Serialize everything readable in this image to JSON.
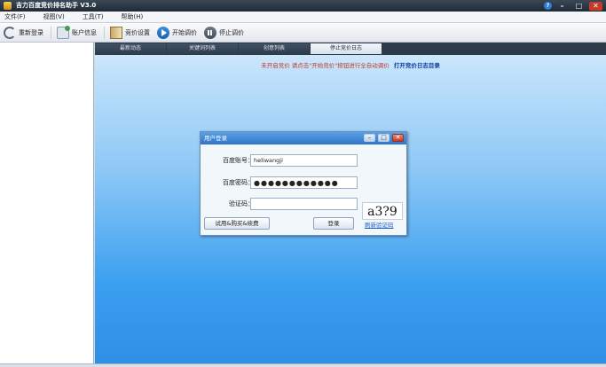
{
  "window": {
    "title": "吉力百度竞价排名助手 V3.0"
  },
  "menu": {
    "items": [
      "文件(F)",
      "视图(V)",
      "工具(T)",
      "帮助(H)"
    ]
  },
  "toolbar": {
    "relogin": "重新登录",
    "account": "账户信息",
    "bid_settings": "竞价设置",
    "start": "开始调价",
    "stop": "停止调价"
  },
  "tabs": [
    "最新动态",
    "关键词列表",
    "创意列表",
    "停止竞价日志"
  ],
  "notice": {
    "warning": "未开启竞价  请点击\"开始竞价\"按钮进行全自动调价",
    "link": "打开竞价日志目录"
  },
  "dialog": {
    "title": "用户登录",
    "username_label": "百度账号：",
    "username_value": "heliwangji",
    "password_label": "百度密码：",
    "password_value": "●●●●●●●●●●●●",
    "captcha_label": "验证码：",
    "captcha_value": "",
    "captcha_text": "a3?9",
    "trial_button": "试用&购买&续费",
    "login_button": "登录",
    "refresh_captcha": "刷新验证码"
  },
  "colors": {
    "accent": "#2f74c6",
    "warning": "#c23a2a",
    "link": "#123ea8"
  }
}
